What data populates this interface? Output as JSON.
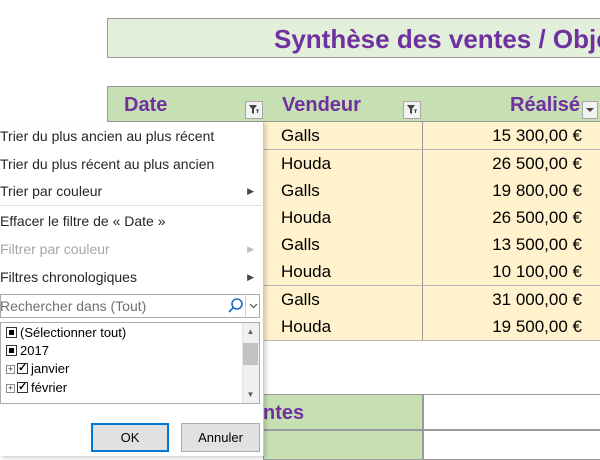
{
  "sheet": {
    "title": "Synthèse des ventes / Obje",
    "headers": {
      "date": "Date",
      "vendeur": "Vendeur",
      "realise": "Réalisé"
    },
    "rows": [
      {
        "vendeur": "Galls",
        "realise": "15 300,00 €"
      },
      {
        "vendeur": "Houda",
        "realise": "26 500,00 €"
      },
      {
        "vendeur": "Galls",
        "realise": "19 800,00 €"
      },
      {
        "vendeur": "Houda",
        "realise": "26 500,00 €"
      },
      {
        "vendeur": "Galls",
        "realise": "13 500,00 €"
      },
      {
        "vendeur": "Houda",
        "realise": "10 100,00 €"
      },
      {
        "vendeur": "Galls",
        "realise": "31 000,00 €"
      },
      {
        "vendeur": "Houda",
        "realise": "19 500,00 €"
      }
    ],
    "section_label": "ntes"
  },
  "filter_menu": {
    "sort_asc": "Trier du plus ancien au plus récent",
    "sort_desc": "Trier du plus récent au plus ancien",
    "sort_color": "Trier par couleur",
    "clear_filter": "Effacer le filtre de « Date »",
    "filter_color": "Filtrer par couleur",
    "chrono_filters": "Filtres chronologiques",
    "search_placeholder": "Rechercher dans (Tout)",
    "tree": {
      "select_all": "(Sélectionner tout)",
      "year": "2017",
      "months": [
        "janvier",
        "février"
      ]
    },
    "ok_label": "OK",
    "cancel_label": "Annuler"
  },
  "colors": {
    "title_text": "#7030a0",
    "header_fill": "#c6e0b4",
    "title_fill": "#e2efda",
    "cell_fill": "#fff2cc",
    "ok_border": "#0078d7"
  }
}
